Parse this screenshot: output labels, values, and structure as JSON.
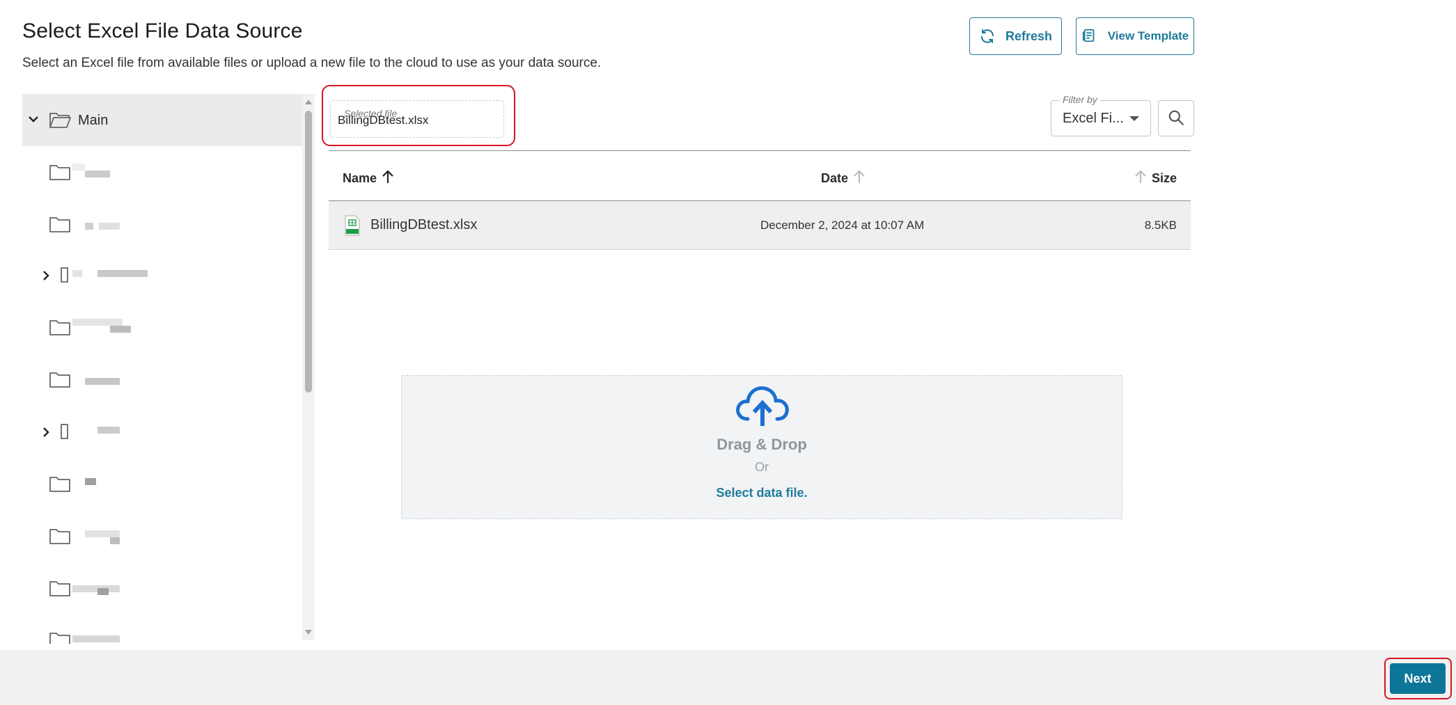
{
  "header": {
    "title": "Select Excel File Data Source",
    "subtitle": "Select an Excel file from available files or upload a new file to the cloud to use as your data source.",
    "refresh_label": "Refresh",
    "view_template_label": "View Template"
  },
  "tree": {
    "root_label": "Main",
    "items": [
      {
        "icon": "folder-icon",
        "expandable": false
      },
      {
        "icon": "folder-icon",
        "expandable": false
      },
      {
        "icon": "folder-icon",
        "expandable": true
      },
      {
        "icon": "folder-icon",
        "expandable": false
      },
      {
        "icon": "folder-icon",
        "expandable": false
      },
      {
        "icon": "folder-icon",
        "expandable": true
      },
      {
        "icon": "folder-icon",
        "expandable": false
      },
      {
        "icon": "folder-icon",
        "expandable": false
      },
      {
        "icon": "folder-icon",
        "expandable": false
      },
      {
        "icon": "folder-icon",
        "expandable": false
      }
    ]
  },
  "selected_file": {
    "label": "Selected file",
    "value": "BillingDBtest.xlsx"
  },
  "filter": {
    "label": "Filter by",
    "value": "Excel Fi..."
  },
  "table": {
    "columns": {
      "name": "Name",
      "date": "Date",
      "size": "Size"
    },
    "rows": [
      {
        "name": "BillingDBtest.xlsx",
        "date": "December 2, 2024 at 10:07 AM",
        "size": "8.5KB",
        "icon": "excel-file-icon"
      }
    ]
  },
  "dropzone": {
    "title": "Drag & Drop",
    "or": "Or",
    "link": "Select data file."
  },
  "footer": {
    "next_label": "Next"
  },
  "colors": {
    "accent": "#1f7a9c",
    "primary_button": "#0d7698",
    "highlight": "#d9141f",
    "cloud_icon": "#1a6fd1"
  }
}
